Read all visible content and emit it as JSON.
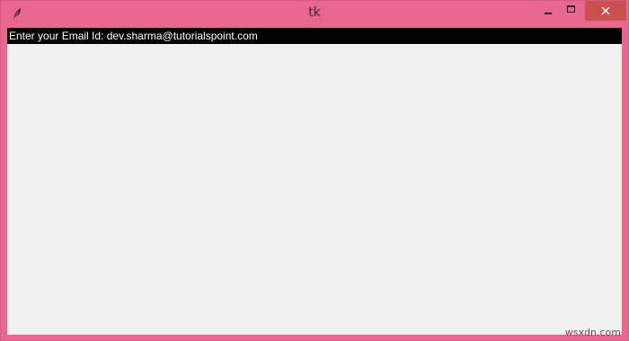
{
  "window": {
    "title": "tk",
    "icon": "feather-icon",
    "controls": {
      "minimize_icon": "minimize-icon",
      "maximize_icon": "maximize-icon",
      "close_icon": "close-icon"
    },
    "colors": {
      "frame": "#e8668f",
      "close_button": "#c9504f",
      "client_bg": "#f0f0f0",
      "label_bg": "#000000",
      "label_fg": "#ffffff"
    }
  },
  "content": {
    "email_label": "Enter your Email Id: dev.sharma@tutorialspoint.com"
  },
  "watermark": "wsxdn.com"
}
